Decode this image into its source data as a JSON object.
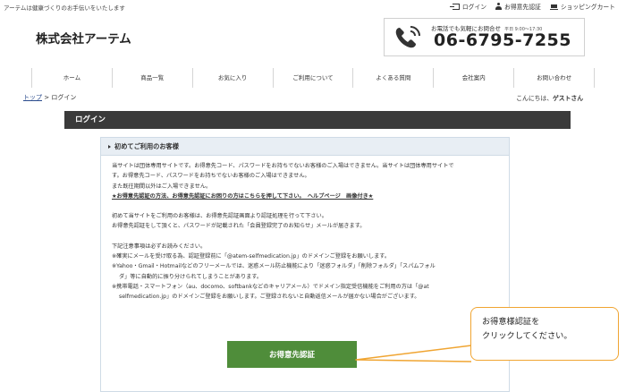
{
  "topbar": {
    "tagline": "アーテムは健康づくりのお手伝いをいたします",
    "links": [
      {
        "icon": "login-icon",
        "label": "ログイン"
      },
      {
        "icon": "user-icon",
        "label": "お得意先認証"
      },
      {
        "icon": "cart-icon",
        "label": "ショッピングカート"
      }
    ]
  },
  "header": {
    "logo": "株式会社アーテム",
    "phone": {
      "note": "お電話でも気軽にお問合せ",
      "hours": "平日 9:00～17:30",
      "number": "06-6795-7255",
      "icon": "phone-icon"
    }
  },
  "nav": {
    "items": [
      "ホーム",
      "商品一覧",
      "お気に入り",
      "ご利用について",
      "よくある質問",
      "会社案内",
      "お問い合わせ"
    ]
  },
  "breadcrumb": {
    "home": "トップ",
    "separator": "> ",
    "current": "ログイン"
  },
  "greeting": {
    "prefix": "こんにちは、",
    "name": "ゲストさん"
  },
  "page": {
    "title": "ログイン"
  },
  "panel": {
    "title": "初めてご利用のお客様",
    "lines": [
      "当サイトは団体専用サイトです。お得意先コード、パスワードをお持ちでないお客様のご入場はできません。当サイトは団体専用サイトで",
      "す。お得意先コード、パスワードをお持ちでないお客様のご入場はできません。",
      "また既往期間以外はご入場できません。",
      "★お得意先認証の方法、お得意先認証にお困りの方はこちらを押して下さい。　ヘルプページ　画像付き★",
      "",
      "初めて当サイトをご利用のお客様は、お得意先認証画面より認証処理を行って下さい。",
      "お得意先認証をして頂くと、パスワードが記載された「会員登録完了のお知らせ」メールが届きます。",
      "",
      "下記注意事項は必ずお読みください。",
      "※確実にメールを受け取る為、認証登録前に「@atem-selfmedication.jp」のドメインご登録をお願いします。",
      "※Yahoo・Gmail・Hotmailなどのフリーメールでは、迷惑メール防止機能により「迷惑フォルダ」「削除フォルダ」「スパムフォル",
      "ダ」等に自動的に振り分けられてしまうことがあります。",
      "※携帯電話・スマートフォン（au、docomo、softbankなどのキャリアメール）でドメイン指定受信機能をご利用の方は「@at",
      "selfmedication.jp」のドメインご登録をお願いします。ご登録されないと自動返信メールが届かない場合がございます。"
    ]
  },
  "auth_button": {
    "label": "お得意先認証"
  },
  "callout": {
    "line1": "お得意様認証を",
    "line2": "クリックしてください。"
  },
  "colors": {
    "button_green": "#4f8d3a",
    "header_dark": "#3a3a3a",
    "callout_border": "#f0a532",
    "panel_head_bg": "#e8eef4"
  }
}
